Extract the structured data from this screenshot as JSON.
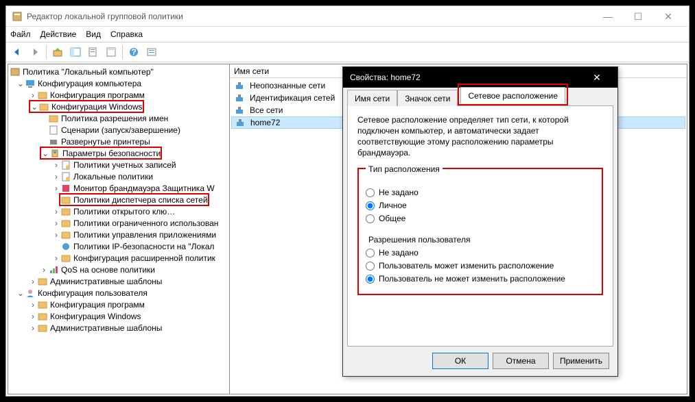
{
  "window": {
    "title": "Редактор локальной групповой политики",
    "min": "—",
    "max": "☐",
    "close": "✕"
  },
  "menu": {
    "file": "Файл",
    "action": "Действие",
    "view": "Вид",
    "help": "Справка"
  },
  "tree": {
    "root": "Политика \"Локальный компьютер\"",
    "compConf": "Конфигурация компьютера",
    "swConf": "Конфигурация программ",
    "winConf": "Конфигурация Windows",
    "nameResPol": "Политика разрешения имен",
    "scripts": "Сценарии (запуск/завершение)",
    "deployed": "Развернутые принтеры",
    "secParams": "Параметры безопасности",
    "acctPol": "Политики учетных записей",
    "localPol": "Локальные политики",
    "fwMon": "Монитор брандмауэра Защитника W",
    "nlmPol": "Политики диспетчера списка сетей",
    "pkPol": "Политики открытого клю…",
    "restrUse": "Политики ограниченного использован",
    "appCtrl": "Политики управления приложениями",
    "ipsec": "Политики IP-безопасности на \"Локал",
    "advAudit": "Конфигурация расширенной политик",
    "qos": "QoS на основе политики",
    "adminT1": "Административные шаблоны",
    "userConf": "Конфигурация пользователя",
    "swConf2": "Конфигурация программ",
    "winConf2": "Конфигурация Windows",
    "adminT2": "Административные шаблоны"
  },
  "list": {
    "header": "Имя сети",
    "items": [
      "Неопознанные сети",
      "Идентификация сетей",
      "Все сети",
      "home72"
    ]
  },
  "dialog": {
    "title": "Свойства: home72",
    "tabs": {
      "name": "Имя сети",
      "icon": "Значок сети",
      "loc": "Сетевое расположение"
    },
    "desc": "Сетевое расположение определяет тип сети, к которой подключен компьютер, и автоматически задает соответствующие этому расположению параметры брандмауэра.",
    "locType": {
      "legend": "Тип расположения",
      "opt1": "Не задано",
      "opt2": "Личное",
      "opt3": "Общее"
    },
    "userPerm": {
      "legend": "Разрешения пользователя",
      "opt1": "Не задано",
      "opt2": "Пользователь может изменить расположение",
      "opt3": "Пользователь не может изменить расположение"
    },
    "ok": "ОК",
    "cancel": "Отмена",
    "apply": "Применить"
  }
}
